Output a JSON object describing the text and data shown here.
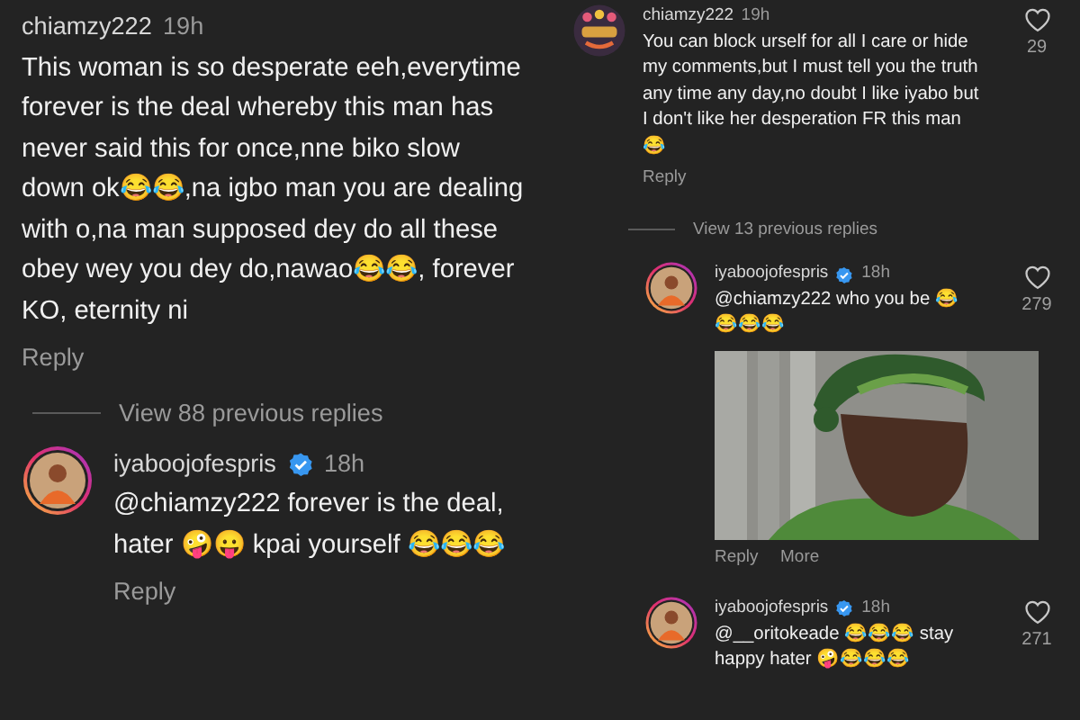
{
  "left_panel": {
    "comment": {
      "username": "chiamzy222",
      "verified": false,
      "time": "19h",
      "text": "This woman is so desperate eeh,everytime forever is the deal whereby this man has never said this for once,nne biko slow down ok😂😂,na igbo man you are dealing with o,na man supposed dey do all these obey wey you dey do,nawao😂😂, forever KO, eternity ni",
      "actions": [
        "Reply"
      ]
    },
    "view_replies": "View 88 previous replies",
    "replies": [
      {
        "username": "iyaboojofespris",
        "verified": true,
        "time": "18h",
        "text": "@chiamzy222 forever is the deal, hater 🤪😛 kpai yourself 😂😂😂",
        "actions": [
          "Reply"
        ],
        "avatar": {
          "ring": true
        }
      }
    ]
  },
  "right_panel": {
    "comment": {
      "username": "chiamzy222",
      "verified": false,
      "time": "19h",
      "text": "You can block urself for all I care or hide my comments,but I must tell you the truth any time any day,no doubt I like iyabo but I don't like her desperation FR this man😂",
      "actions": [
        "Reply"
      ],
      "avatar": {
        "ring": false
      },
      "likes": "29"
    },
    "view_replies": "View 13 previous replies",
    "replies": [
      {
        "username": "iyaboojofespris",
        "verified": true,
        "time": "18h",
        "text": "@chiamzy222 who you be 😂😂😂😂",
        "actions": [
          "Reply",
          "More"
        ],
        "avatar": {
          "ring": true
        },
        "likes": "279"
      },
      {
        "username": "iyaboojofespris",
        "verified": true,
        "time": "18h",
        "text": "@__oritokeade 😂😂😂 stay happy hater 🤪😂😂😂",
        "avatar": {
          "ring": true
        },
        "likes": "271"
      }
    ]
  }
}
